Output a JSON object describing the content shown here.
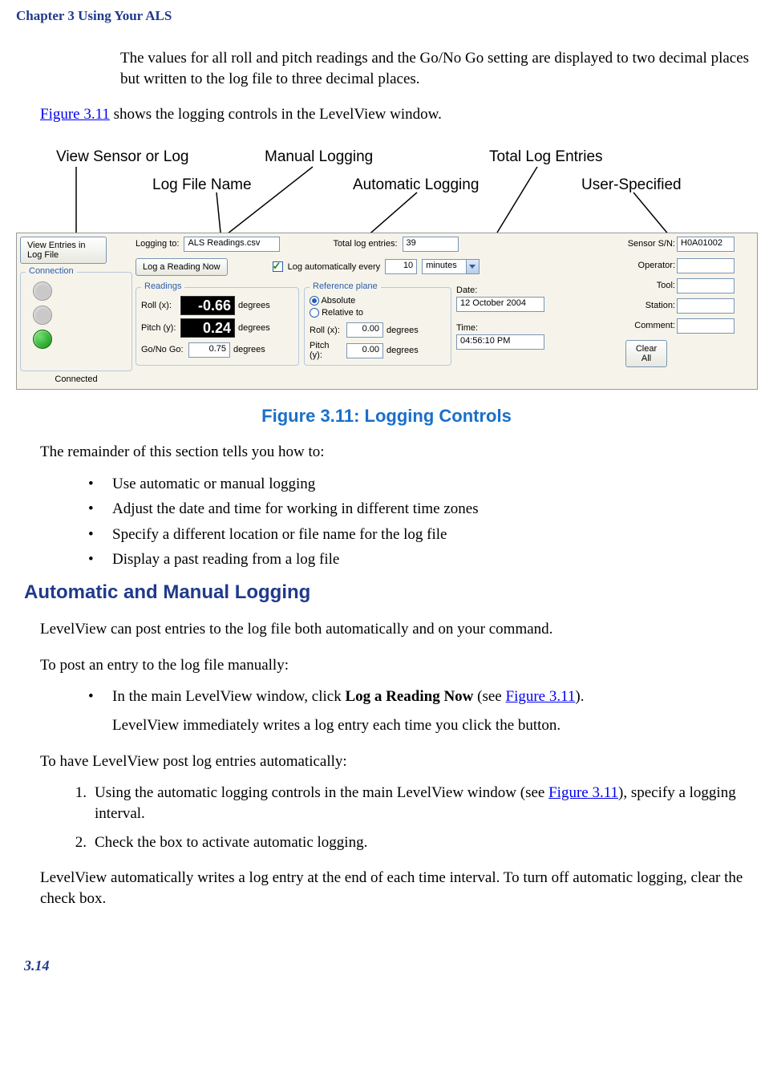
{
  "chapter_header": "Chapter 3  Using Your ALS",
  "para1": "The values for all roll and pitch readings and the Go/No Go setting are displayed to two decimal places but written to the log file to three decimal places.",
  "para2_pre": "",
  "para2_link": "Figure 3.11",
  "para2_post": " shows the logging controls in the LevelView window.",
  "callouts": {
    "view_sensor": "View Sensor or Log",
    "log_file_name": "Log File Name",
    "manual_logging": "Manual Logging",
    "automatic_logging": "Automatic Logging",
    "total_log_entries": "Total Log Entries",
    "user_specified": "User-Specified"
  },
  "screenshot": {
    "view_entries_btn": "View Entries in Log File",
    "connection_title": "Connection",
    "connected_label": "Connected",
    "logging_to_label": "Logging to:",
    "logging_to_value": "ALS Readings.csv",
    "total_log_label": "Total log entries:",
    "total_log_value": "39",
    "log_now_btn": "Log a Reading Now",
    "log_auto_label": "Log automatically every",
    "log_auto_value": "10",
    "log_auto_unit": "minutes",
    "readings_title": "Readings",
    "roll_x_label": "Roll (x):",
    "roll_x_value": "-0.66",
    "pitch_y_label": "Pitch (y):",
    "pitch_y_value": "0.24",
    "degrees_label": "degrees",
    "gonogo_label": "Go/No Go:",
    "gonogo_value": "0.75",
    "refplane_title": "Reference plane",
    "absolute_label": "Absolute",
    "relative_label": "Relative to",
    "ref_roll_label": "Roll (x):",
    "ref_roll_value": "0.00",
    "ref_pitch_label": "Pitch (y):",
    "ref_pitch_value": "0.00",
    "date_label": "Date:",
    "date_value": "12 October 2004",
    "time_label": "Time:",
    "time_value": "04:56:10 PM",
    "sensor_sn_label": "Sensor S/N:",
    "sensor_sn_value": "H0A01002",
    "operator_label": "Operator:",
    "tool_label": "Tool:",
    "station_label": "Station:",
    "comment_label": "Comment:",
    "clear_all_btn": "Clear All"
  },
  "figure_caption": "Figure 3.11: Logging Controls",
  "remainder_intro": "The remainder of this section tells you how to:",
  "bullets": [
    "Use automatic or manual logging",
    "Adjust the date and time for working in different time zones",
    "Specify a different location or file name for the log file",
    "Display a past reading from a log file"
  ],
  "section_heading": "Automatic and Manual Logging",
  "auto_para1": "LevelView can post entries to the log file both automatically and on your command.",
  "auto_para2": "To post an entry to the log file manually:",
  "manual_bullet_pre": "In the main LevelView window, click ",
  "manual_bullet_bold": "Log a Reading Now",
  "manual_bullet_post": " (see ",
  "manual_bullet_link": "Figure 3.11",
  "manual_bullet_close": ").",
  "manual_bullet_line2": "LevelView immediately writes a log entry each time you click the button.",
  "auto_para3": "To have LevelView post log entries automatically:",
  "steps": {
    "s1_pre": "Using the automatic logging controls in the main LevelView window (see ",
    "s1_link": "Figure 3.11",
    "s1_post": "), specify a logging interval.",
    "s2": "Check the box to activate automatic logging."
  },
  "auto_para4": "LevelView automatically writes a log entry at the end of each time interval. To turn off automatic logging, clear the check box.",
  "page_number": "3.14"
}
